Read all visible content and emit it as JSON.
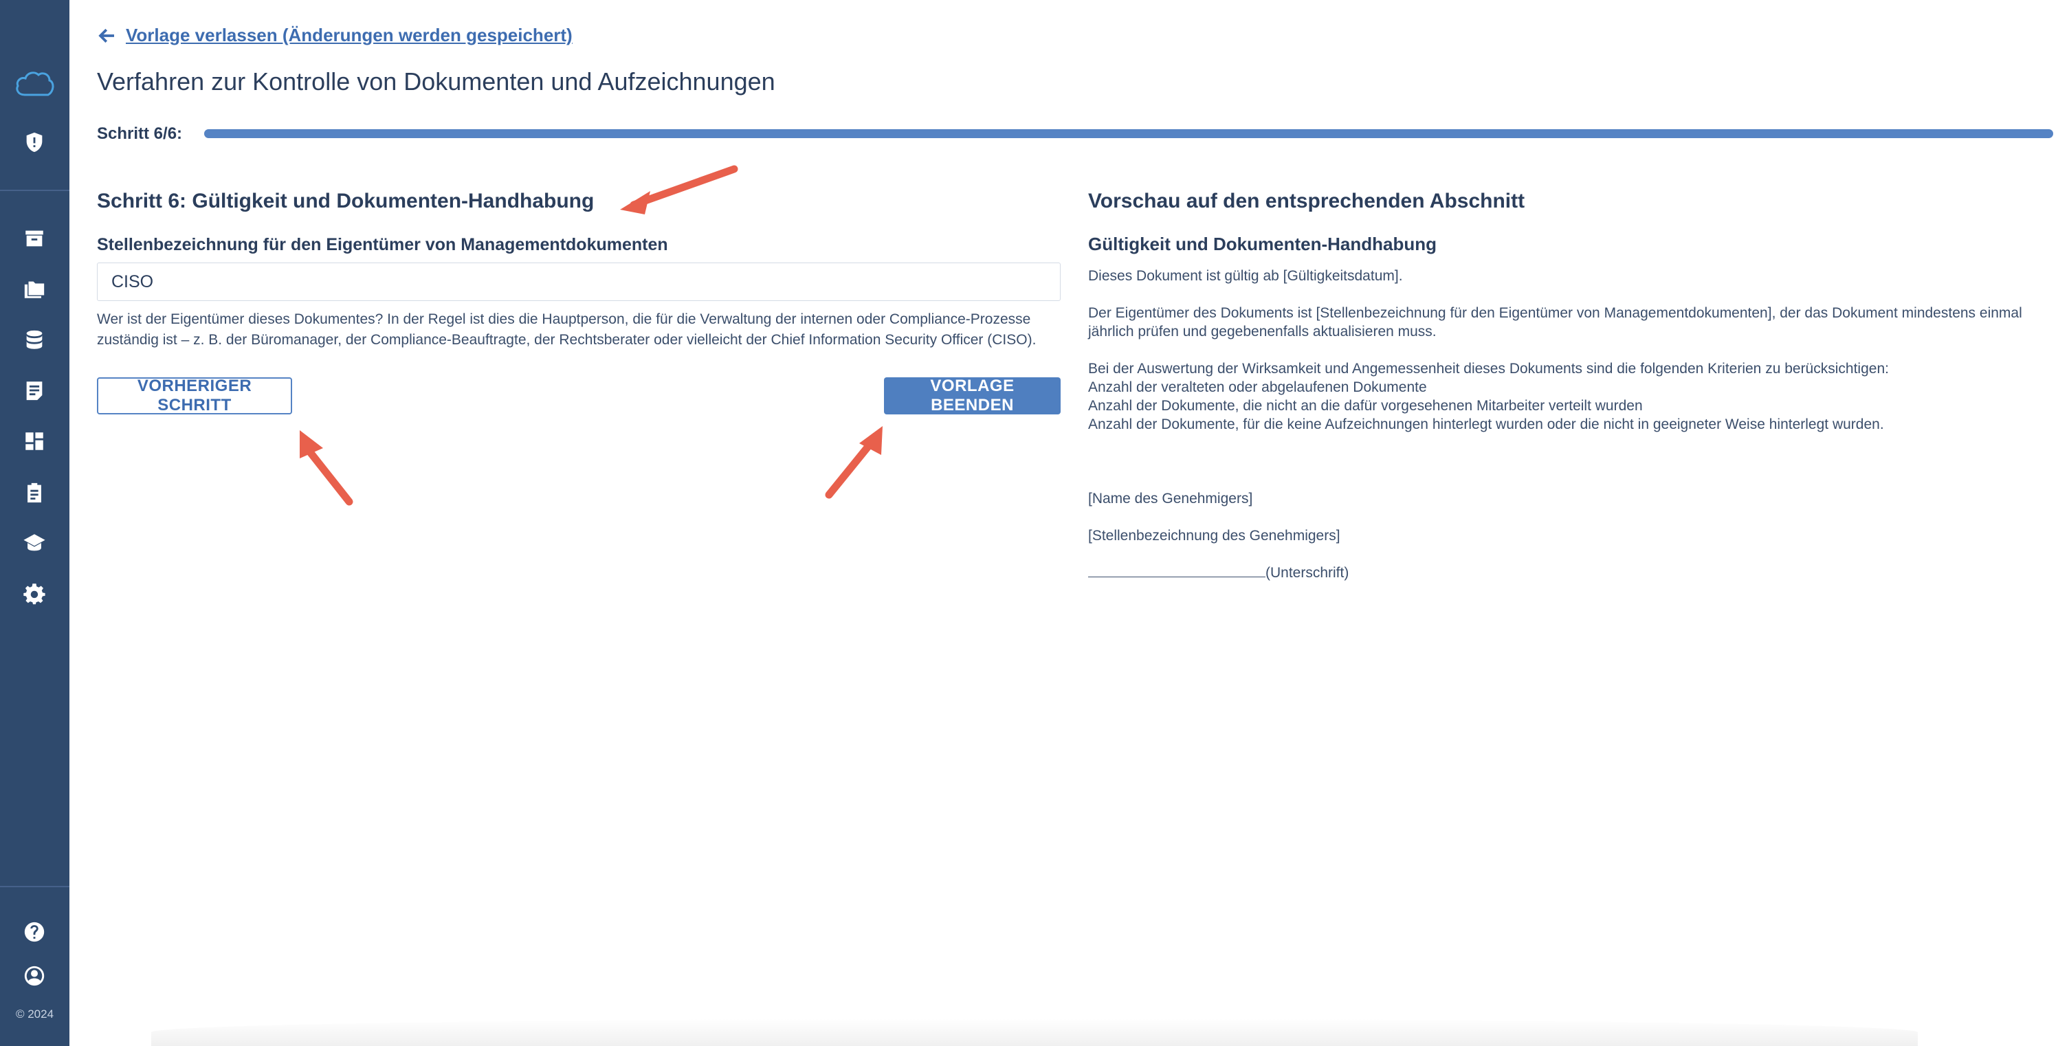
{
  "sidebar": {
    "icons": [
      "cloud-logo-icon",
      "shield-icon",
      "archive-icon",
      "folders-icon",
      "database-icon",
      "document-icon",
      "dashboard-icon",
      "clipboard-icon",
      "graduation-cap-icon",
      "gear-icon",
      "help-icon",
      "user-icon"
    ],
    "copyright": "© 2024"
  },
  "header": {
    "back_link": "Vorlage verlassen (Änderungen werden gespeichert)",
    "title": "Verfahren zur Kontrolle von Dokumenten und Aufzeichnungen"
  },
  "progress": {
    "label": "Schritt 6/6:",
    "fraction": 1.0
  },
  "form": {
    "section_title": "Schritt 6: Gültigkeit und Dokumenten-Handhabung",
    "field_label": "Stellenbezeichnung für den Eigentümer von Managementdokumenten",
    "field_value": "CISO",
    "help_text": "Wer ist der Eigentümer dieses Dokumentes? In der Regel ist dies die Hauptperson, die für die Verwaltung der internen oder Compliance-Prozesse zuständig ist – z. B. der Büromanager, der Compliance-Beauftragte, der Rechtsberater oder vielleicht der Chief Information Security Officer (CISO).",
    "prev_button": "VORHERIGER SCHRITT",
    "finish_button": "VORLAGE BEENDEN"
  },
  "preview": {
    "title": "Vorschau auf den entsprechenden Abschnitt",
    "subtitle": "Gültigkeit und Dokumenten-Handhabung",
    "p1": "Dieses Dokument ist gültig ab [Gültigkeitsdatum].",
    "p2": "Der Eigentümer des Dokuments ist [Stellenbezeichnung für den Eigentümer von Managementdokumenten], der das Dokument mindestens einmal jährlich prüfen und gegebenenfalls aktualisieren muss.",
    "p3": "Bei der Auswertung der Wirksamkeit und Angemessenheit dieses Dokuments sind die folgenden Kriterien zu berücksichtigen:",
    "criteria": [
      "Anzahl der veralteten oder abgelaufenen Dokumente",
      "Anzahl der Dokumente, die nicht an die dafür vorgesehenen Mitarbeiter verteilt wurden",
      "Anzahl der Dokumente, für die keine Aufzeichnungen hinterlegt wurden oder die nicht in geeigneter Weise hinterlegt wurden."
    ],
    "approver_name": "[Name des Genehmigers]",
    "approver_title": "[Stellenbezeichnung des Genehmigers]",
    "signature": "(Unterschrift)"
  },
  "colors": {
    "sidebar": "#2f4a6d",
    "accent": "#4f7fc0",
    "text": "#2b3e5c",
    "annotation_arrow": "#e8604c"
  }
}
